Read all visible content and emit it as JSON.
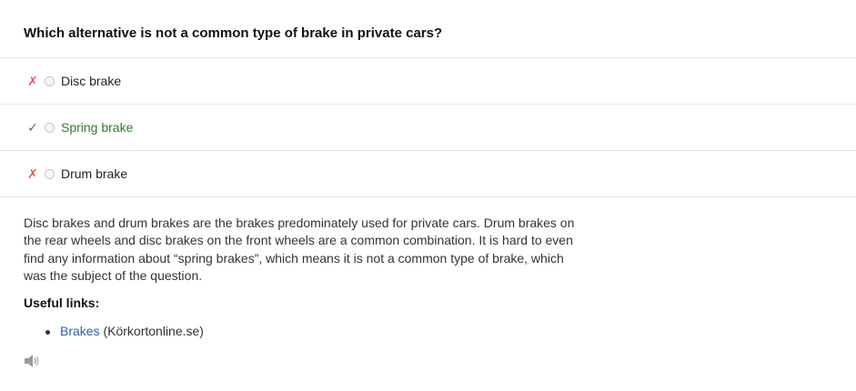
{
  "question": {
    "text": "Which alternative is not a common type of brake in private cars?"
  },
  "options": [
    {
      "label": "Disc brake",
      "mark": "✗",
      "status": "incorrect"
    },
    {
      "label": "Spring brake",
      "mark": "✓",
      "status": "correct"
    },
    {
      "label": "Drum brake",
      "mark": "✗",
      "status": "incorrect"
    }
  ],
  "explanation": {
    "text": "Disc brakes and drum brakes are the brakes predominately used for private cars. Drum brakes on the rear wheels and disc brakes on the front wheels are a common combination. It is hard to even find any information about “spring brakes”, which means it is not a common type of brake, which was the subject of the question."
  },
  "useful_links": {
    "title": "Useful links:",
    "items": [
      {
        "link_text": "Brakes",
        "source": "(Körkortonline.se)"
      }
    ]
  },
  "icons": {
    "audio": "speaker-icon"
  },
  "colors": {
    "correct": "#2e7d2e",
    "incorrect": "#e05a5a",
    "link": "#2b63a8"
  }
}
